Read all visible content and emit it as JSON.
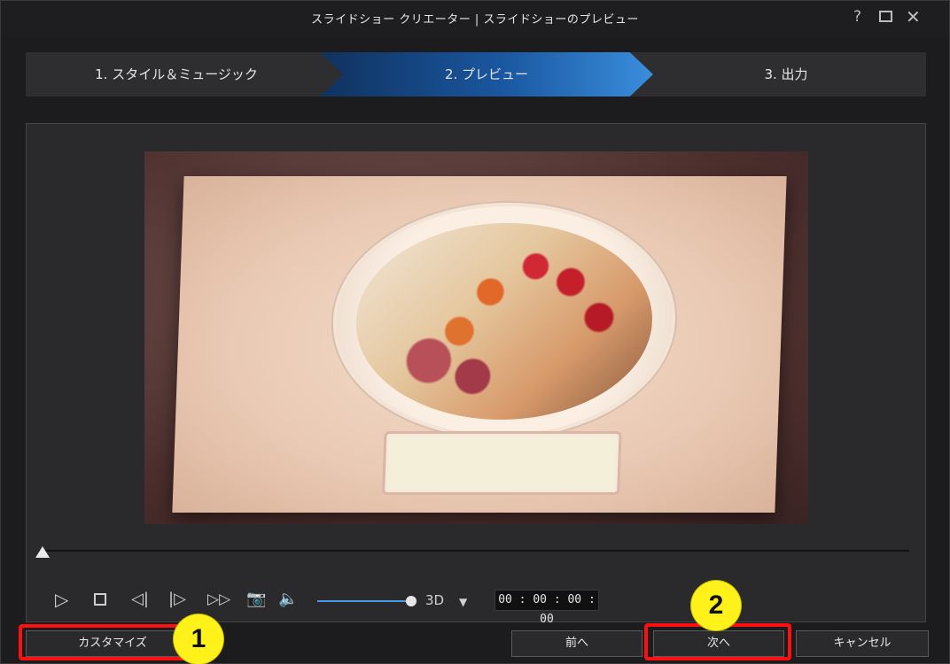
{
  "window": {
    "title": "スライドショー クリエーター | スライドショーのプレビュー",
    "help_label": "?",
    "close_label": "✕"
  },
  "steps": [
    {
      "label": "1. スタイル＆ミュージック",
      "active": false
    },
    {
      "label": "2. プレビュー",
      "active": true
    },
    {
      "label": "3. 出力",
      "active": false
    }
  ],
  "player": {
    "play_icon": "▷",
    "prev_icon": "◁|",
    "next_icon": "|▷",
    "ff_icon": "▷▷",
    "snapshot_icon": "📷",
    "volume_icon": "🔈",
    "volume_level": 1.0,
    "mode_label": "3D",
    "mode_dropdown_icon": "▼",
    "timecode": "00 : 00 : 00 : 00",
    "seek_position": 0
  },
  "buttons": {
    "customize": "カスタマイズ",
    "back": "前へ",
    "next": "次へ",
    "cancel": "キャンセル"
  },
  "annotations": {
    "badge1": "1",
    "badge2": "2",
    "highlight_color": "#ff1010",
    "badge_color": "#fff21a"
  }
}
